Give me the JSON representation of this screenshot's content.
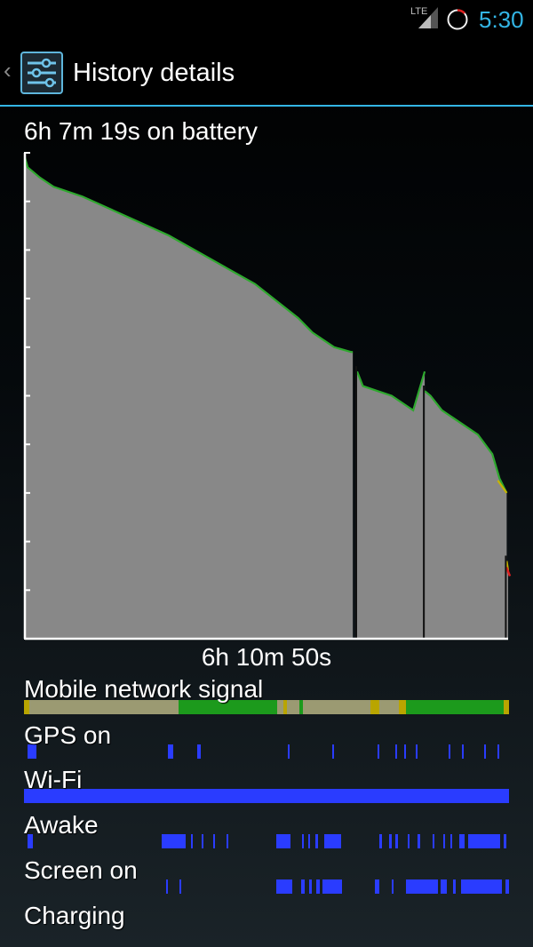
{
  "status_bar": {
    "network": "LTE",
    "time": "5:30"
  },
  "action_bar": {
    "title": "History details"
  },
  "battery": {
    "on_battery_label": "6h 7m 19s on battery",
    "duration_label": "6h 10m 50s"
  },
  "rows": [
    {
      "label": "Mobile network signal"
    },
    {
      "label": "GPS on"
    },
    {
      "label": "Wi-Fi"
    },
    {
      "label": "Awake"
    },
    {
      "label": "Screen on"
    },
    {
      "label": "Charging"
    }
  ],
  "colors": {
    "accent": "#33b5e5",
    "graph_fill": "#888888",
    "graph_line_good": "#2ea82e",
    "graph_line_mid": "#c8b400",
    "graph_line_low": "#e02020",
    "timeline": "#2a3cff",
    "signal_good": "#1c9a1c",
    "signal_weak": "#9b9a72"
  },
  "chart_data": {
    "type": "area",
    "title": "",
    "xlabel": "6h 10m 50s",
    "ylabel": "",
    "ylim": [
      0,
      100
    ],
    "x_unit": "minutes",
    "series": [
      {
        "segments": [
          {
            "x": [
              0,
              2,
              10,
              20,
              40,
              70,
              100,
              130,
              160,
              190,
              200,
              215,
              227,
              228
            ],
            "y": [
              99,
              97,
              95,
              93,
              91,
              87,
              83,
              78,
              73,
              66,
              63,
              60,
              59,
              59
            ]
          },
          {
            "x": [
              231,
              235,
              245,
              255,
              270,
              278
            ],
            "y": [
              55,
              52,
              51,
              50,
              47,
              55
            ]
          },
          {
            "x": [
              278,
              282,
              290,
              305,
              315,
              325,
              330,
              335
            ],
            "y": [
              51,
              50,
              47,
              44,
              42,
              38,
              33,
              30
            ]
          },
          {
            "x": [
              335,
              336
            ],
            "y": [
              16,
              14
            ]
          }
        ]
      }
    ],
    "timelines": {
      "Mobile network signal": "mixed (green = good, olive = weak)",
      "GPS on": "intermittent",
      "Wi-Fi": "on entire period",
      "Awake": "intermittent",
      "Screen on": "intermittent",
      "Charging": "off"
    }
  }
}
